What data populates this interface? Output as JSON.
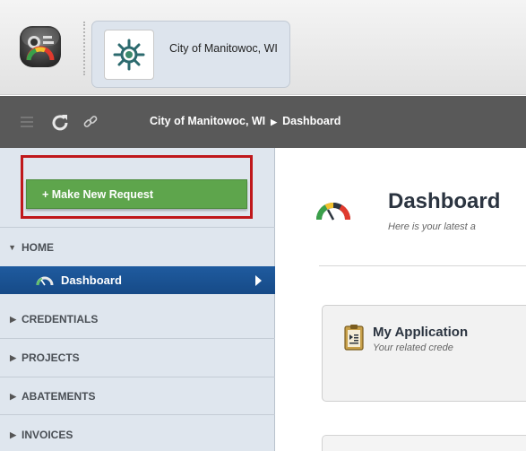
{
  "header": {
    "org_name": "City of Manitowoc, WI"
  },
  "toolbar": {
    "breadcrumb": [
      "City of Manitowoc, WI",
      "Dashboard"
    ]
  },
  "sidebar": {
    "request_button": "+ Make New Request",
    "sections": {
      "home": "HOME",
      "credentials": "CREDENTIALS",
      "projects": "PROJECTS",
      "abatements": "ABATEMENTS",
      "invoices": "INVOICES"
    },
    "active_item": "Dashboard"
  },
  "main": {
    "title": "Dashboard",
    "subtitle": "Here is your latest a",
    "card": {
      "title": "My Application",
      "subtitle": "Your related crede"
    }
  },
  "colors": {
    "toolbar": "#595959",
    "request_green": "#5ea54c",
    "highlight_red": "#c0181b",
    "active_blue": "#1f5b9f",
    "sidebar_bg": "#dfe6ee"
  }
}
